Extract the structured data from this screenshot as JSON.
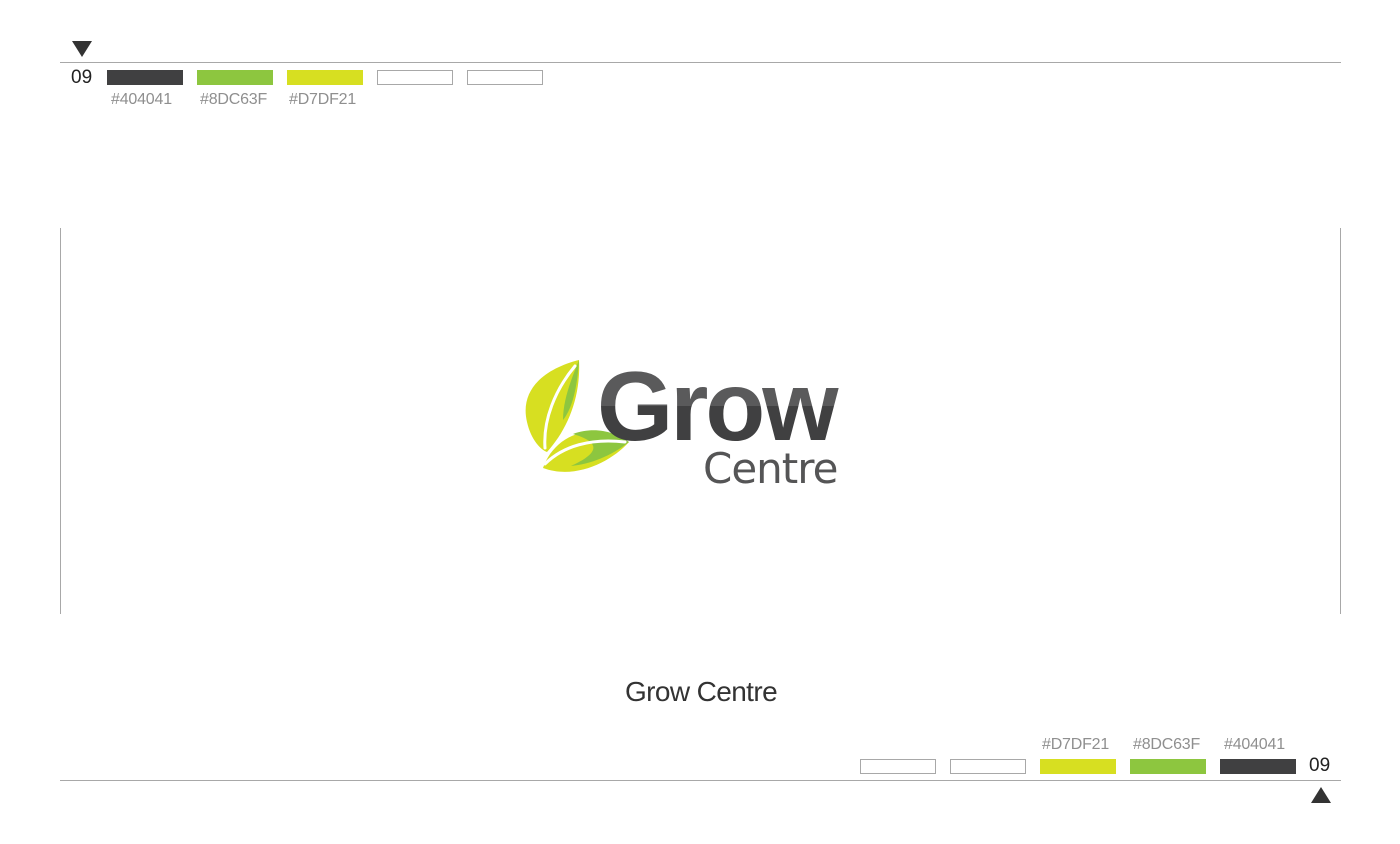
{
  "top": {
    "number": "09",
    "swatches": [
      {
        "color": "#404041",
        "label": "#404041"
      },
      {
        "color": "#8DC63F",
        "label": "#8DC63F"
      },
      {
        "color": "#D7DF21",
        "label": "#D7DF21"
      },
      {
        "color": "",
        "label": ""
      },
      {
        "color": "",
        "label": ""
      }
    ]
  },
  "logo": {
    "word1": "Grow",
    "word2": "Centre",
    "colors": {
      "dark": "#404041",
      "green": "#8DC63F",
      "yellow": "#D7DF21"
    }
  },
  "caption": "Grow Centre",
  "bottom": {
    "number": "09",
    "swatches": [
      {
        "color": "",
        "label": ""
      },
      {
        "color": "",
        "label": ""
      },
      {
        "color": "#D7DF21",
        "label": "#D7DF21"
      },
      {
        "color": "#8DC63F",
        "label": "#8DC63F"
      },
      {
        "color": "#404041",
        "label": "#404041"
      }
    ]
  }
}
